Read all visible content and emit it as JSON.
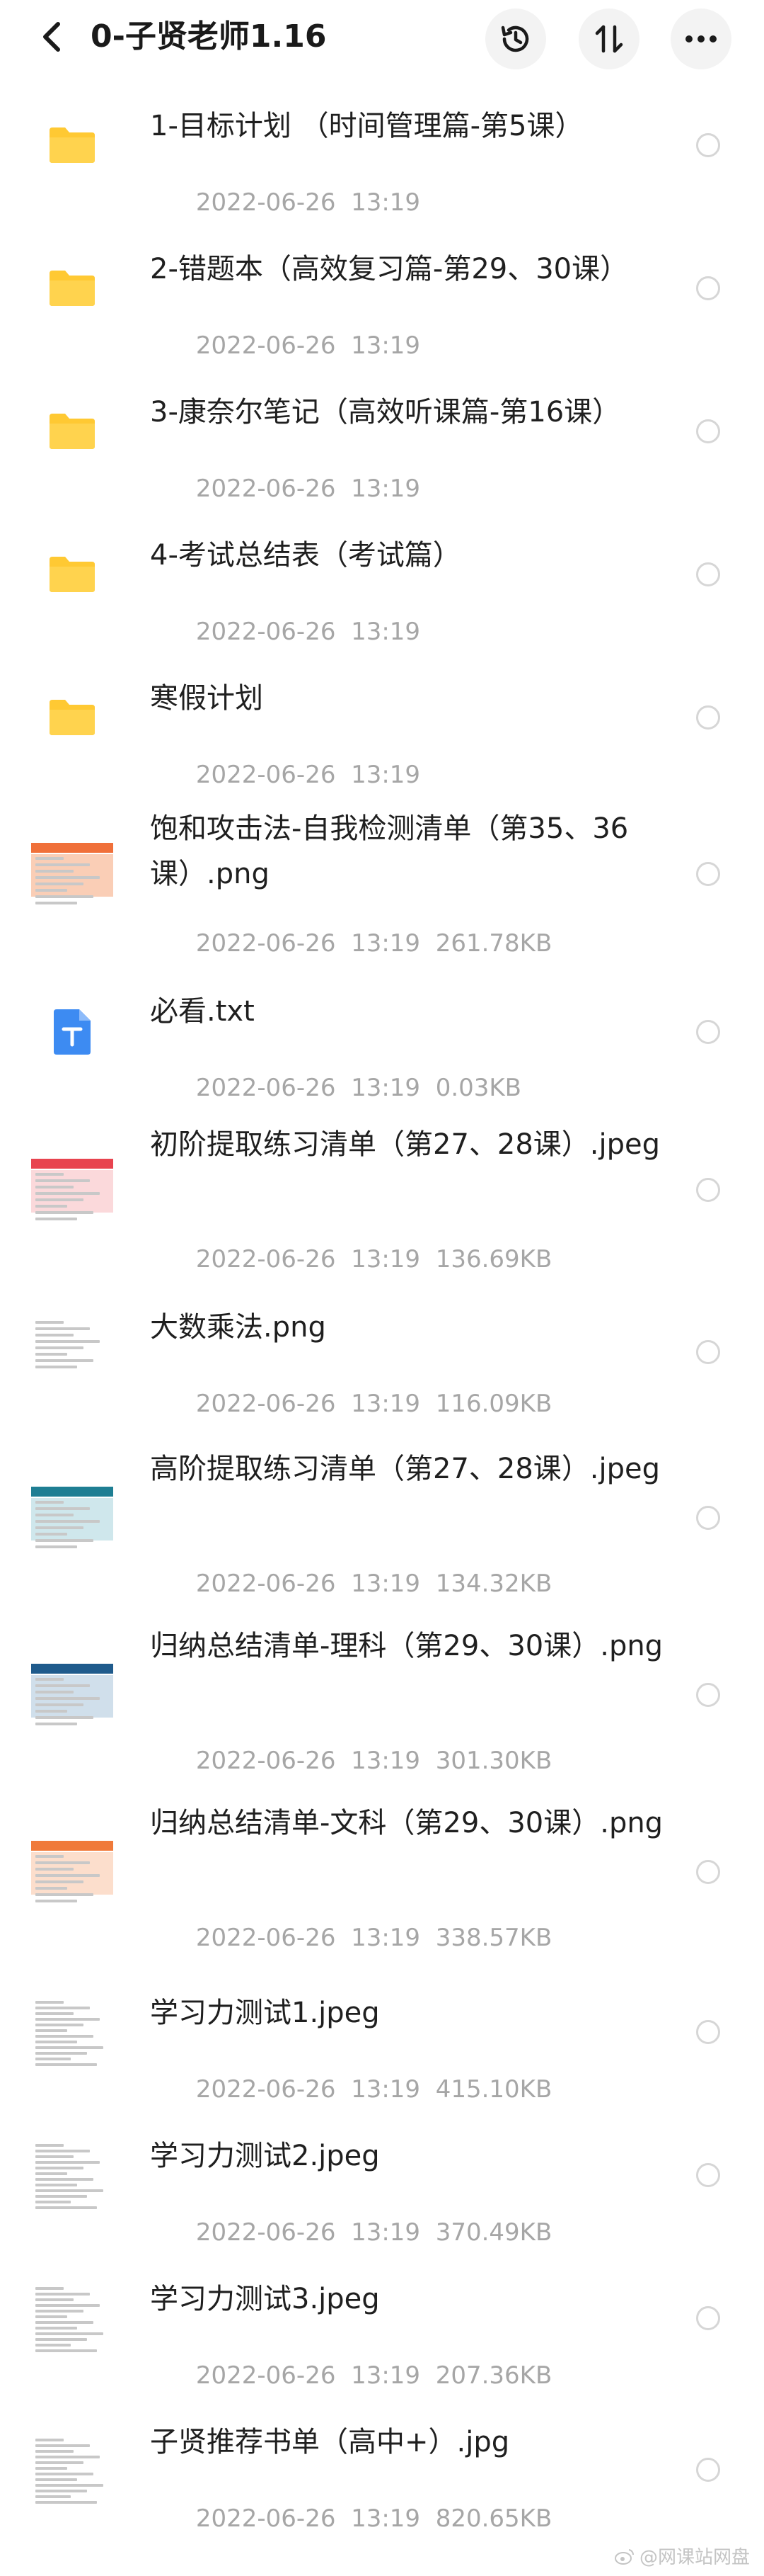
{
  "header": {
    "title": "0-子贤老师1.16",
    "back_icon": "chevron-left-icon",
    "history_icon": "history-icon",
    "sort_icon": "sort-icon",
    "more_icon": "more-icon"
  },
  "files": [
    {
      "name": "1-目标计划 （时间管理篇-第5课）",
      "date": "2022-06-26  13:19",
      "size": "",
      "kind": "folder"
    },
    {
      "name": "2-错题本（高效复习篇-第29、30课）",
      "date": "2022-06-26  13:19",
      "size": "",
      "kind": "folder"
    },
    {
      "name": "3-康奈尔笔记（高效听课篇-第16课）",
      "date": "2022-06-26  13:19",
      "size": "",
      "kind": "folder"
    },
    {
      "name": "4-考试总结表（考试篇）",
      "date": "2022-06-26  13:19",
      "size": "",
      "kind": "folder"
    },
    {
      "name": "寒假计划",
      "date": "2022-06-26  13:19",
      "size": "",
      "kind": "folder"
    },
    {
      "name": "饱和攻击法-自我检测清单（第35、36课）.png",
      "date": "2022-06-26  13:19",
      "size": "261.78KB",
      "kind": "image-orange"
    },
    {
      "name": "必看.txt",
      "date": "2022-06-26  13:19",
      "size": "0.03KB",
      "kind": "txt"
    },
    {
      "name": "初阶提取练习清单（第27、28课）.jpeg",
      "date": "2022-06-26  13:19",
      "size": "136.69KB",
      "kind": "image-red"
    },
    {
      "name": "大数乘法.png",
      "date": "2022-06-26  13:19",
      "size": "116.09KB",
      "kind": "image-text"
    },
    {
      "name": "高阶提取练习清单（第27、28课）.jpeg",
      "date": "2022-06-26  13:19",
      "size": "134.32KB",
      "kind": "image-teal"
    },
    {
      "name": "归纳总结清单-理科（第29、30课）.png",
      "date": "2022-06-26  13:19",
      "size": "301.30KB",
      "kind": "image-navy"
    },
    {
      "name": "归纳总结清单-文科（第29、30课）.png",
      "date": "2022-06-26  13:19",
      "size": "338.57KB",
      "kind": "image-orange2"
    },
    {
      "name": "学习力测试1.jpeg",
      "date": "2022-06-26  13:19",
      "size": "415.10KB",
      "kind": "image-doc"
    },
    {
      "name": "学习力测试2.jpeg",
      "date": "2022-06-26  13:19",
      "size": "370.49KB",
      "kind": "image-doc"
    },
    {
      "name": "学习力测试3.jpeg",
      "date": "2022-06-26  13:19",
      "size": "207.36KB",
      "kind": "image-doc"
    },
    {
      "name": "子贤推荐书单（高中+）.jpg",
      "date": "2022-06-26  13:19",
      "size": "820.65KB",
      "kind": "image-doc"
    }
  ],
  "watermark": "@网课站网盘",
  "colors": {
    "folder": "#FFC933",
    "txt_icon": "#3D8BF2",
    "meta_text": "#A6A6A6",
    "radio_border": "#D6D6D6"
  }
}
